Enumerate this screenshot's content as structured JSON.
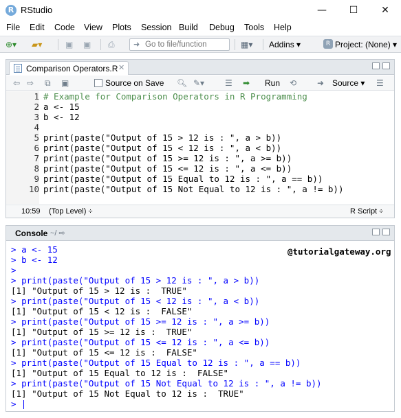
{
  "window": {
    "title": "RStudio",
    "app_icon": "R",
    "minimize": "—",
    "maximize": "☐",
    "close": "✕"
  },
  "menu": [
    "File",
    "Edit",
    "Code",
    "View",
    "Plots",
    "Session",
    "Build",
    "Debug",
    "Tools",
    "Help"
  ],
  "toolbar": {
    "goto_placeholder": "Go to file/function",
    "addins_label": "Addins",
    "project_label": "Project: (None)"
  },
  "editor": {
    "tab_label": "Comparison Operators.R",
    "source_on_save_label": "Source on Save",
    "source_on_save_checked": false,
    "run_label": "Run",
    "source_label": "Source",
    "lines": [
      "# Example for Comparison Operators in R Programming",
      "a <- 15",
      "b <- 12",
      "",
      "print(paste(\"Output of 15 > 12 is : \", a > b))",
      "print(paste(\"Output of 15 < 12 is : \", a < b))",
      "print(paste(\"Output of 15 >= 12 is : \", a >= b))",
      "print(paste(\"Output of 15 <= 12 is : \", a <= b))",
      "print(paste(\"Output of 15 Equal to 12 is : \", a == b))",
      "print(paste(\"Output of 15 Not Equal to 12 is : \", a != b))"
    ],
    "line_numbers": [
      "1",
      "2",
      "3",
      "4",
      "5",
      "6",
      "7",
      "8",
      "9",
      "10"
    ],
    "status": {
      "position": "10:59",
      "scope": "(Top Level) ÷",
      "file_type": "R Script ÷"
    }
  },
  "console": {
    "title": "Console",
    "path": "~/",
    "watermark": "@tutorialgateway.org",
    "lines": [
      {
        "type": "input",
        "prompt": ">",
        "text": "a <- 15"
      },
      {
        "type": "input",
        "prompt": ">",
        "text": "b <- 12"
      },
      {
        "type": "input",
        "prompt": ">",
        "text": ""
      },
      {
        "type": "input",
        "prompt": ">",
        "text": "print(paste(\"Output of 15 > 12 is : \", a > b))"
      },
      {
        "type": "output",
        "prompt": "",
        "text": "[1] \"Output of 15 > 12 is :  TRUE\""
      },
      {
        "type": "input",
        "prompt": ">",
        "text": "print(paste(\"Output of 15 < 12 is : \", a < b))"
      },
      {
        "type": "output",
        "prompt": "",
        "text": "[1] \"Output of 15 < 12 is :  FALSE\""
      },
      {
        "type": "input",
        "prompt": ">",
        "text": "print(paste(\"Output of 15 >= 12 is : \", a >= b))"
      },
      {
        "type": "output",
        "prompt": "",
        "text": "[1] \"Output of 15 >= 12 is :  TRUE\""
      },
      {
        "type": "input",
        "prompt": ">",
        "text": "print(paste(\"Output of 15 <= 12 is : \", a <= b))"
      },
      {
        "type": "output",
        "prompt": "",
        "text": "[1] \"Output of 15 <= 12 is :  FALSE\""
      },
      {
        "type": "input",
        "prompt": ">",
        "text": "print(paste(\"Output of 15 Equal to 12 is : \", a == b))"
      },
      {
        "type": "output",
        "prompt": "",
        "text": "[1] \"Output of 15 Equal to 12 is :  FALSE\""
      },
      {
        "type": "input",
        "prompt": ">",
        "text": "print(paste(\"Output of 15 Not Equal to 12 is : \", a != b))"
      },
      {
        "type": "output",
        "prompt": "",
        "text": "[1] \"Output of 15 Not Equal to 12 is :  TRUE\""
      },
      {
        "type": "input",
        "prompt": ">",
        "text": ""
      }
    ]
  }
}
